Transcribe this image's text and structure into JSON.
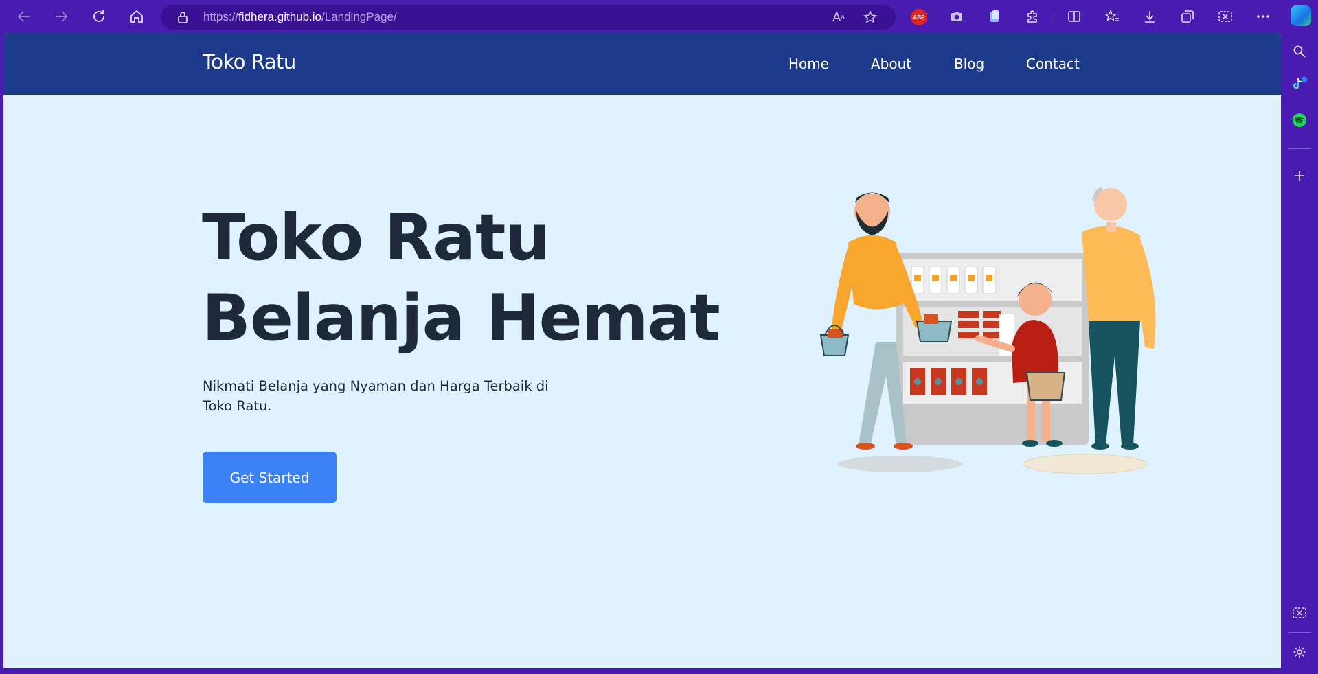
{
  "browser": {
    "url_prefix": "https://",
    "url_host": "fidhera.github.io",
    "url_path": "/LandingPage/",
    "read_aloud_label": "A",
    "abp_label": "ABP"
  },
  "navbar": {
    "brand": "Toko Ratu",
    "links": [
      {
        "label": "Home"
      },
      {
        "label": "About"
      },
      {
        "label": "Blog"
      },
      {
        "label": "Contact"
      }
    ]
  },
  "hero": {
    "title_line1": "Toko Ratu",
    "title_line2": "Belanja Hemat",
    "subtitle": "Nikmati Belanja yang Nyaman dan Harga Terbaik di Toko Ratu.",
    "cta_label": "Get Started"
  },
  "colors": {
    "browser_frame": "#4a1bb0",
    "navbar_bg": "#1e3a8a",
    "page_bg": "#e0f2fe",
    "cta_bg": "#3b82f6",
    "heading": "#1e293b"
  },
  "icons": {
    "toolbar": [
      "back-icon",
      "forward-icon",
      "refresh-icon",
      "home-icon",
      "lock-icon",
      "read-aloud-icon",
      "favorite-star-icon",
      "adblock-plus-icon",
      "camera-icon",
      "browser-essentials-icon",
      "extensions-icon",
      "split-screen-icon",
      "favorites-icon",
      "downloads-icon",
      "collections-icon",
      "screenshot-icon",
      "more-icon",
      "copilot-icon"
    ],
    "sidebar": [
      "search-icon",
      "tiktok-icon",
      "spotify-icon",
      "add-icon",
      "screenshot-icon",
      "settings-icon"
    ]
  }
}
